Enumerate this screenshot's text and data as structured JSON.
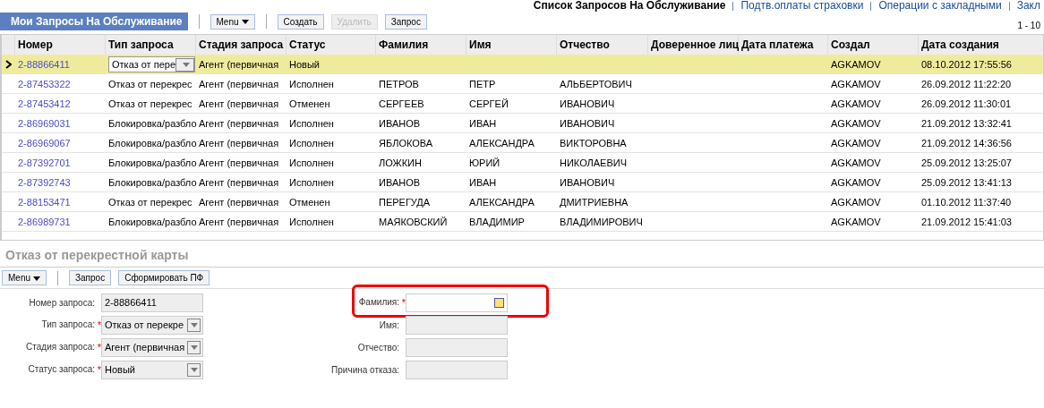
{
  "top_links": [
    {
      "label": "Список Запросов На Обслуживание",
      "selected": true
    },
    {
      "label": "Подтв.оплаты страховки",
      "selected": false
    },
    {
      "label": "Операции с закладными",
      "selected": false
    },
    {
      "label": "Закл",
      "selected": false
    }
  ],
  "list": {
    "title": "Мои Запросы На Обслуживание",
    "toolbar": [
      {
        "label": "Menu",
        "kind": "menu",
        "disabled": false
      },
      {
        "label": "Создать",
        "kind": "button",
        "disabled": false
      },
      {
        "label": "Удалить",
        "kind": "button",
        "disabled": true
      },
      {
        "label": "Запрос",
        "kind": "button",
        "disabled": false
      }
    ],
    "pager": "1 - 10",
    "columns": [
      "Номер",
      "Тип запроса",
      "Стадия запроса",
      "Статус",
      "Фамилия",
      "Имя",
      "Отчество",
      "Доверенное лиц",
      "Дата платежа",
      "Создал",
      "Дата создания"
    ],
    "rows": [
      {
        "selected": true,
        "cells": [
          "2-88866411",
          "Отказ от пере",
          "Агент (первичная",
          "Новый",
          "",
          "",
          "",
          "",
          "",
          "AGKAMOV",
          "08.10.2012 17:55:56"
        ]
      },
      {
        "selected": false,
        "cells": [
          "2-87453322",
          "Отказ от перекрес",
          "Агент (первичная",
          "Исполнен",
          "ПЕТРОВ",
          "ПЕТР",
          "АЛЬБЕРТОВИЧ",
          "",
          "",
          "AGKAMOV",
          "26.09.2012 11:22:20"
        ]
      },
      {
        "selected": false,
        "cells": [
          "2-87453412",
          "Отказ от перекрес",
          "Агент (первичная",
          "Отменен",
          "СЕРГЕЕВ",
          "СЕРГЕЙ",
          "ИВАНОВИЧ",
          "",
          "",
          "AGKAMOV",
          "26.09.2012 11:30:01"
        ]
      },
      {
        "selected": false,
        "cells": [
          "2-86969031",
          "Блокировка/разбло",
          "Агент (первичная",
          "Исполнен",
          "ИВАНОВ",
          "ИВАН",
          "ИВАНОВИЧ",
          "",
          "",
          "AGKAMOV",
          "21.09.2012 13:32:41"
        ]
      },
      {
        "selected": false,
        "cells": [
          "2-86969067",
          "Блокировка/разбло",
          "Агент (первичная",
          "Исполнен",
          "ЯБЛОКОВА",
          "АЛЕКСАНДРА",
          "ВИКТОРОВНА",
          "",
          "",
          "AGKAMOV",
          "21.09.2012 14:36:56"
        ]
      },
      {
        "selected": false,
        "cells": [
          "2-87392701",
          "Блокировка/разбло",
          "Агент (первичная",
          "Исполнен",
          "ЛОЖКИН",
          "ЮРИЙ",
          "НИКОЛАЕВИЧ",
          "",
          "",
          "AGKAMOV",
          "25.09.2012 13:25:07"
        ]
      },
      {
        "selected": false,
        "cells": [
          "2-87392743",
          "Блокировка/разбло",
          "Агент (первичная",
          "Исполнен",
          "ИВАНОВ",
          "ИВАН",
          "ИВАНОВИЧ",
          "",
          "",
          "AGKAMOV",
          "25.09.2012 13:41:13"
        ]
      },
      {
        "selected": false,
        "cells": [
          "2-88153471",
          "Отказ от перекрес",
          "Агент (первичная",
          "Отменен",
          "ПЕРЕГУДА",
          "АЛЕКСАНДРА",
          "ДМИТРИЕВНА",
          "",
          "",
          "AGKAMOV",
          "01.10.2012 11:37:40"
        ]
      },
      {
        "selected": false,
        "cells": [
          "2-86989731",
          "Блокировка/разбло",
          "Агент (первичная",
          "Исполнен",
          "МАЯКОВСКИЙ",
          "ВЛАДИМИР",
          "ВЛАДИМИРОВИЧ",
          "",
          "",
          "AGKAMOV",
          "21.09.2012 15:41:03"
        ]
      }
    ]
  },
  "detail": {
    "title": "Отказ от перекрестной карты",
    "toolbar": [
      {
        "label": "Menu",
        "kind": "menu"
      },
      {
        "label": "Запрос",
        "kind": "button"
      },
      {
        "label": "Сформировать ПФ",
        "kind": "button"
      }
    ],
    "left_fields": [
      {
        "label": "Номер запроса:",
        "value": "2-88866411",
        "kind": "text"
      },
      {
        "label": "Тип запроса:",
        "value": "Отказ от перекре",
        "required_mark": "*",
        "kind": "select"
      },
      {
        "label": "Стадия запроса:",
        "value": "Агент (первичная",
        "required_mark": "*",
        "kind": "select"
      },
      {
        "label": "Статус запроса:",
        "value": "Новый",
        "required_mark": "*",
        "kind": "select"
      }
    ],
    "right_fields": [
      {
        "label": "Фамилия:",
        "required_mark": "*",
        "kind": "picker",
        "highlighted": true
      },
      {
        "label": "Имя:",
        "kind": "text",
        "highlighted": false
      },
      {
        "label": "Отчество:",
        "kind": "text",
        "highlighted": false
      },
      {
        "label": "Причина отказа:",
        "kind": "text",
        "highlighted": false
      }
    ]
  }
}
